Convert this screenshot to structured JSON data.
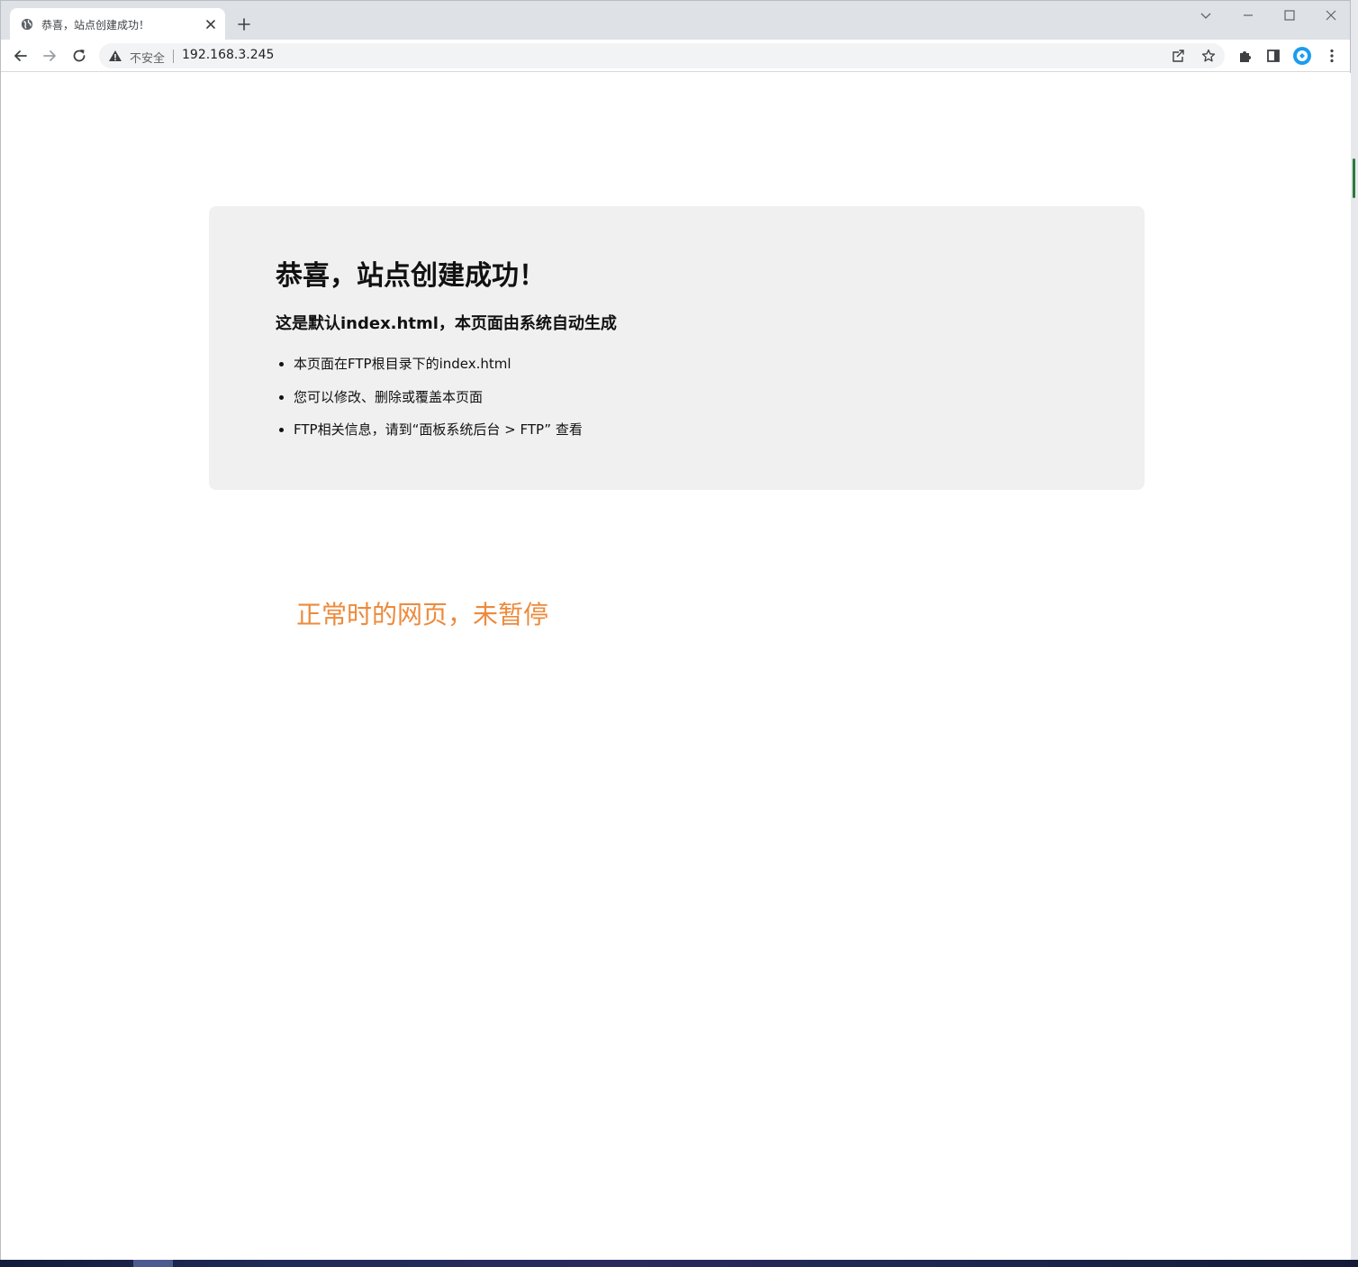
{
  "browser": {
    "tab": {
      "title": "恭喜，站点创建成功！",
      "favicon": "globe-icon",
      "close_icon": "close-icon"
    },
    "new_tab_icon": "plus-icon",
    "window_controls": [
      "tab-search-icon",
      "minimize-icon",
      "maximize-icon",
      "close-icon"
    ],
    "toolbar": {
      "back_icon": "arrow-left-icon",
      "forward_icon": "arrow-right-icon",
      "reload_icon": "reload-icon",
      "security_icon": "warning-triangle-icon",
      "security_label": "不安全",
      "url": "192.168.3.245",
      "share_icon": "share-icon",
      "bookmark_icon": "star-icon",
      "extensions_icon": "puzzle-icon",
      "side_panel_icon": "side-panel-icon",
      "profile_icon": "profile-avatar-icon",
      "menu_icon": "kebab-menu-icon"
    }
  },
  "page": {
    "heading": "恭喜，站点创建成功！",
    "subheading": "这是默认index.html，本页面由系统自动生成",
    "items": [
      "本页面在FTP根目录下的index.html",
      "您可以修改、删除或覆盖本页面",
      "FTP相关信息，请到“面板系统后台 > FTP” 查看"
    ]
  },
  "annotation": {
    "text": "正常时的网页，未暂停",
    "color": "#ed8a3c"
  },
  "colors": {
    "card_bg": "#f0f0f0",
    "tabstrip_bg": "#dee1e6",
    "omnibox_bg": "#f1f3f4",
    "profile_accent": "#1a9cf0"
  }
}
